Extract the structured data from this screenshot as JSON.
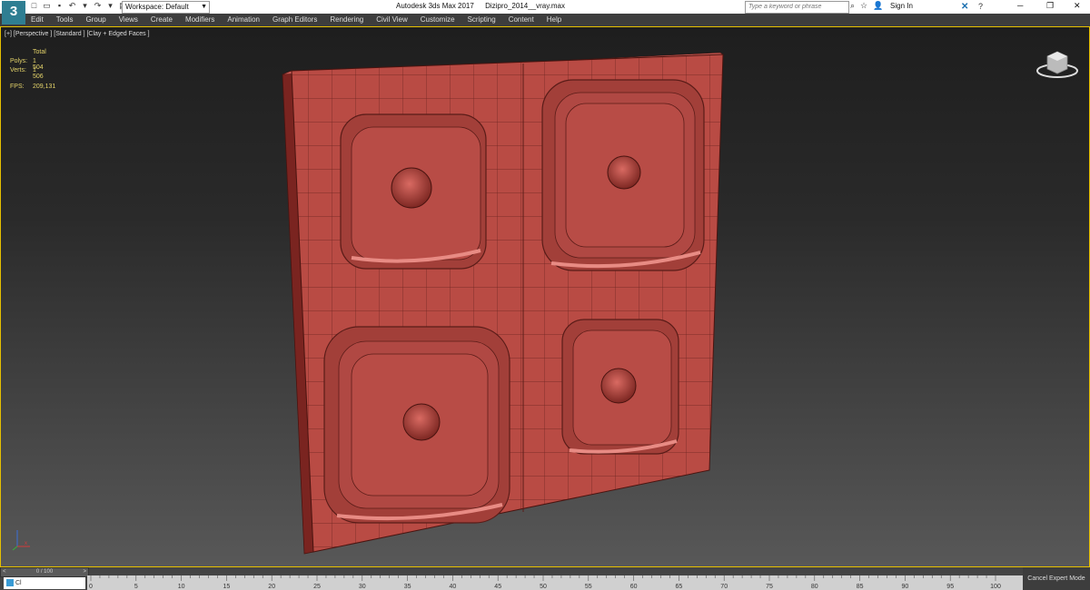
{
  "app": {
    "logo": "3",
    "title": "Autodesk 3ds Max 2017",
    "file": "Dizipro_2014__vray.max",
    "workspace": "Workspace: Default",
    "search_placeholder": "Type a keyword or phrase",
    "sign_in": "Sign In"
  },
  "icons": {
    "qat": [
      "new-icon",
      "open-icon",
      "save-icon",
      "undo-icon",
      "redo-icon",
      "project-icon"
    ],
    "glyphs": [
      "□",
      "▭",
      "▪",
      "↶",
      "↷",
      "▤"
    ]
  },
  "menu": [
    "Edit",
    "Tools",
    "Group",
    "Views",
    "Create",
    "Modifiers",
    "Animation",
    "Graph Editors",
    "Rendering",
    "Civil View",
    "Customize",
    "Scripting",
    "Content",
    "Help"
  ],
  "viewport": {
    "label": "[+] [Perspective ] [Standard ] [Clay + Edged Faces ]",
    "stats": {
      "header": "Total",
      "polys_label": "Polys:",
      "polys_value": "1 504",
      "verts_label": "Verts:",
      "verts_value": "1 506",
      "fps_label": "FPS:",
      "fps_value": "209,131"
    }
  },
  "timeline": {
    "frame": "0 / 100",
    "ticks": [
      "0",
      "5",
      "10",
      "15",
      "20",
      "25",
      "30",
      "35",
      "40",
      "45",
      "50",
      "55",
      "60",
      "65",
      "70",
      "75",
      "80",
      "85",
      "90",
      "95",
      "100"
    ],
    "cancel_expert": "Cancel Expert Mode",
    "script_text": "Cl"
  },
  "colors": {
    "panel": "#b94b44",
    "panel_dark": "#8a2a25",
    "highlight": "#e88b84",
    "viewport_border": "#e6c000",
    "stats_text": "#e5d46a"
  }
}
